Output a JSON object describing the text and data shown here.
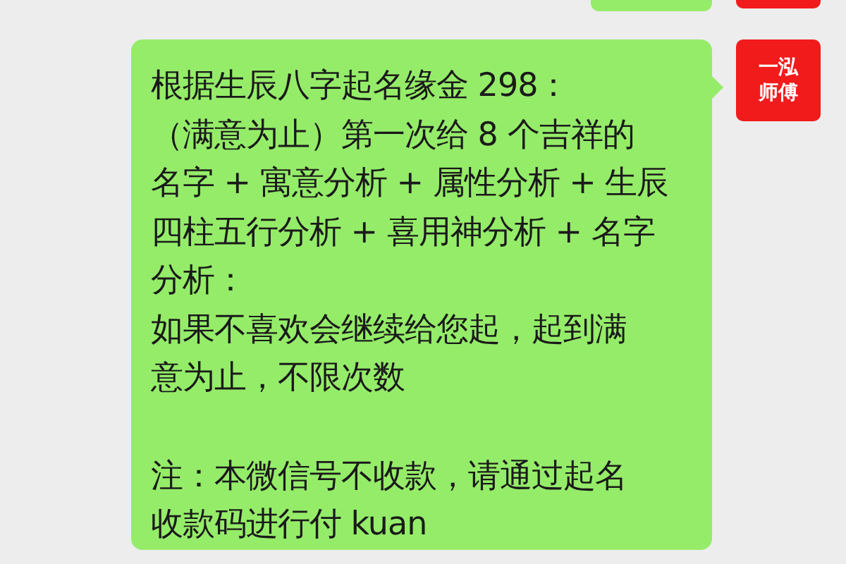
{
  "message": {
    "sender_avatar": {
      "lines": [
        "一泓",
        "师傅"
      ]
    },
    "paragraphs": [
      [
        "根据生辰八字起名缘金 298：",
        "（满意为止）第一次给 8 个吉祥的",
        "名字 + 寓意分析 + 属性分析 + 生辰",
        "四柱五行分析 + 喜用神分析 + 名字",
        "分析：",
        "如果不喜欢会继续给您起，起到满",
        "意为止，不限次数"
      ],
      [
        "注：本微信号不收款，请通过起名",
        "收款码进行付 kuan"
      ]
    ]
  }
}
